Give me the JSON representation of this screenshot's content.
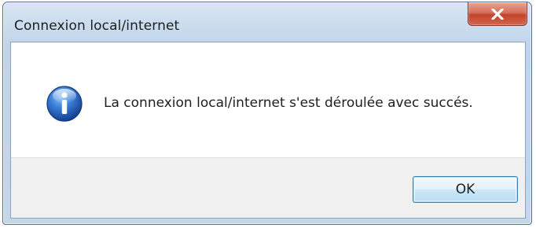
{
  "window": {
    "title": "Connexion local/internet",
    "close_icon": "close-icon"
  },
  "message": {
    "icon": "info-icon",
    "text": "La connexion local/internet s'est déroulée avec succés."
  },
  "buttons": {
    "ok_label": "OK"
  },
  "colors": {
    "close_button": "#c4422a",
    "info_icon": "#1f5fb8",
    "ok_button_border": "#3c7fb1"
  }
}
